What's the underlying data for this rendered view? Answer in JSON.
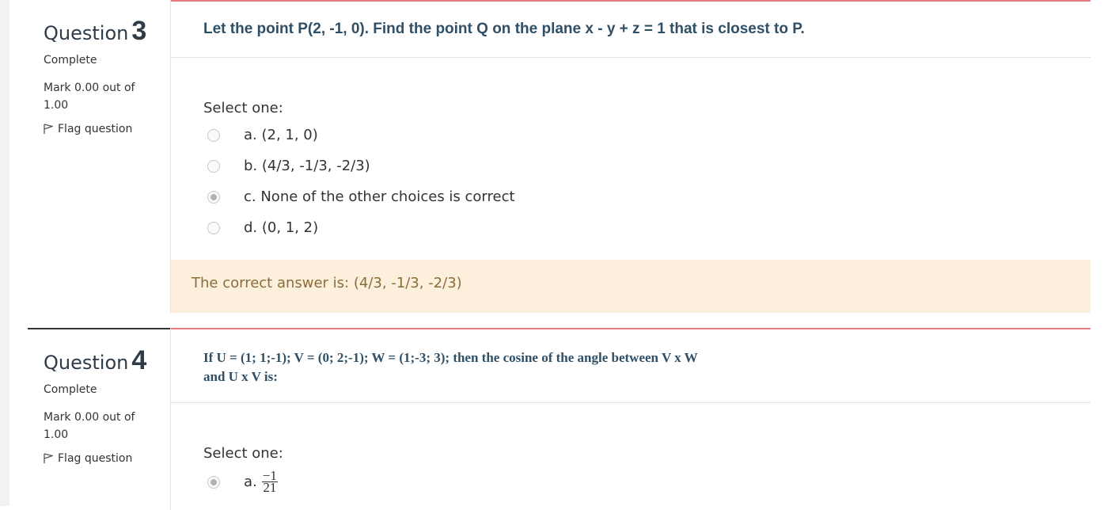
{
  "questions": [
    {
      "label": "Question",
      "number": "3",
      "state": "Complete",
      "grade": "Mark 0.00 out of 1.00",
      "flag_label": "Flag question",
      "text": "Let the point P(2, -1, 0). Find the point Q on the plane x - y + z = 1 that is  closest to P.",
      "select_label": "Select one:",
      "options": [
        {
          "text": "a. (2, 1, 0)",
          "checked": false
        },
        {
          "text": "b. (4/3, -1/3, -2/3)",
          "checked": false
        },
        {
          "text": "c. None of the other choices is correct",
          "checked": true
        },
        {
          "text": "d. (0, 1, 2)",
          "checked": false
        }
      ],
      "feedback": "The correct answer is: (4/3, -1/3, -2/3)"
    },
    {
      "label": "Question",
      "number": "4",
      "state": "Complete",
      "grade": "Mark 0.00 out of 1.00",
      "flag_label": "Flag question",
      "text_line1": "If U = (1; 1;-1); V = (0; 2;-1); W = (1;-3; 3); then the cosine of the angle between V x W",
      "text_line2": "and U x V is:",
      "select_label": "Select one:",
      "options": [
        {
          "prefix": "a.",
          "numerator": "−1",
          "denominator": "21",
          "checked": true
        }
      ]
    }
  ],
  "colors": {
    "accent_red": "#e8797f",
    "feedback_bg": "#fcefdc",
    "feedback_text": "#8a6d3b",
    "question_text": "#2f4f66"
  }
}
